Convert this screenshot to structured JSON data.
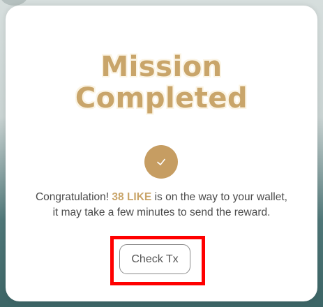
{
  "modal": {
    "title_line1": "Mission",
    "title_line2": "Completed",
    "message": {
      "prefix": "Congratulation! ",
      "amount": "38 LIKE",
      "suffix_line1": " is on the way to your wallet,",
      "line2": "it may take a few minutes to send the reward."
    },
    "button_label": "Check Tx",
    "icon": "checkmark-icon"
  },
  "colors": {
    "accent_gold": "#c9a56a",
    "check_circle": "#c69d62",
    "highlight_box": "#ff0000",
    "body_text": "#4a4a4a"
  }
}
